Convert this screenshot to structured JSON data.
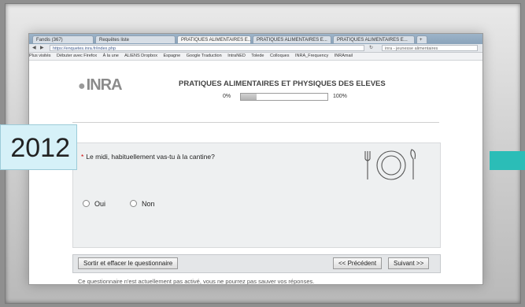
{
  "browser": {
    "tabs": [
      "Fandis (367)",
      "Requêtes liste",
      "PRATIQUES ALIMENTAIRES E...",
      "PRATIQUES ALIMENTAIRES E...",
      "PRATIQUES ALIMENTAIRES E..."
    ],
    "new_tab": "+",
    "address": "https://enquetes.inra.fr/index.php",
    "search": "inra - jeunesse alimentaires",
    "bookmarks": [
      "Plus visités",
      "Débuter avec Firefox",
      "À la une",
      "ALIENS Dropbox",
      "Espagne",
      "Google Traduction",
      "IntraNED",
      "Tolede",
      "Colloques",
      "INRA_Frequency",
      "INRAmail"
    ]
  },
  "page": {
    "logo": "INRA",
    "title": "PRATIQUES ALIMENTAIRES ET PHYSIQUES DES ELEVES",
    "progress": {
      "min_label": "0%",
      "max_label": "100%",
      "value": 0.18
    },
    "question": {
      "required_mark": "*",
      "text": "Le midi, habituellement vas-tu à la cantine?",
      "options": [
        "Oui",
        "Non"
      ]
    },
    "buttons": {
      "exit": "Sortir et effacer le questionnaire",
      "previous": "<< Précédent",
      "next": "Suivant >>"
    },
    "footnote": "Ce questionnaire n'est actuellement pas activé, vous ne pourrez pas sauver vos réponses."
  },
  "overlay": {
    "year_label": "2012",
    "accent": "#2bbdb7"
  }
}
